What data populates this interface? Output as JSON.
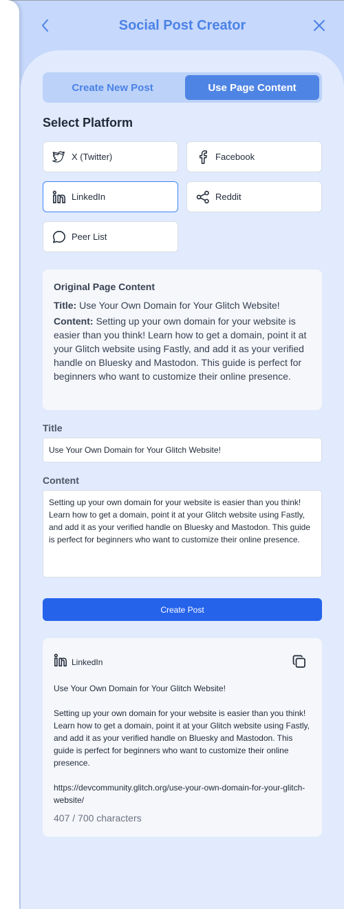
{
  "header": {
    "title": "Social Post Creator"
  },
  "tabs": [
    {
      "label": "Create New Post",
      "active": false
    },
    {
      "label": "Use Page Content",
      "active": true
    }
  ],
  "platform_section": {
    "title": "Select Platform",
    "platforms": [
      {
        "label": "X (Twitter)",
        "icon": "twitter-icon",
        "selected": false
      },
      {
        "label": "Facebook",
        "icon": "facebook-icon",
        "selected": false
      },
      {
        "label": "LinkedIn",
        "icon": "linkedin-icon",
        "selected": true
      },
      {
        "label": "Reddit",
        "icon": "share-icon",
        "selected": false
      },
      {
        "label": "Peer List",
        "icon": "chat-bubble-icon",
        "selected": false
      }
    ]
  },
  "original": {
    "heading": "Original Page Content",
    "title_label": "Title:",
    "title_value": "Use Your Own Domain for Your Glitch Website!",
    "content_label": "Content:",
    "content_value": "Setting up your own domain for your website is easier than you think! Learn how to get a domain, point it at your Glitch website using Fastly, and add it as your verified handle on Bluesky and Mastodon. This guide is perfect for beginners who want to customize their online presence."
  },
  "form": {
    "title_label": "Title",
    "title_value": "Use Your Own Domain for Your Glitch Website!",
    "content_label": "Content",
    "content_value": "Setting up your own domain for your website is easier than you think! Learn how to get a domain, point it at your Glitch website using Fastly, and add it as your verified handle on Bluesky and Mastodon. This guide is perfect for beginners who want to customize their online presence.",
    "create_button": "Create Post"
  },
  "preview": {
    "platform": "LinkedIn",
    "title": "Use Your Own Domain for Your Glitch Website!",
    "body": "Setting up your own domain for your website is easier than you think! Learn how to get a domain, point it at your Glitch website using Fastly, and add it as your verified handle on Bluesky and Mastodon. This guide is perfect for beginners who want to customize their online presence.",
    "url": "https://devcommunity.glitch.org/use-your-own-domain-for-your-glitch-website/",
    "char_count": "407 / 700 characters"
  },
  "colors": {
    "accent": "#4b82e6",
    "primary_button": "#2563eb",
    "background": "#c6d8fb",
    "panel": "#e1ebfd"
  }
}
